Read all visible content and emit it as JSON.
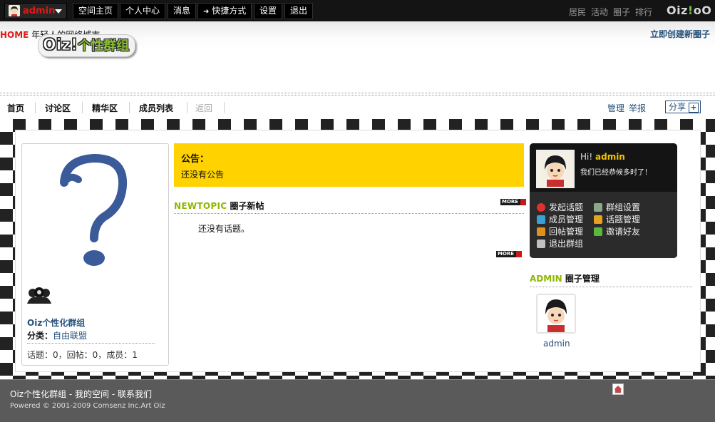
{
  "topbar": {
    "user_name": "admin",
    "nav": [
      "空间主页",
      "个人中心",
      "消息",
      "快捷方式",
      "设置",
      "退出"
    ],
    "right_links": [
      "居民",
      "活动",
      "圈子",
      "排行"
    ],
    "brand": {
      "part1": "Oiz",
      "part2": "!",
      "part3": "oO"
    }
  },
  "header": {
    "home": "HOME",
    "tagline": "年轻人的网络城市",
    "create": "立即创建新圈子",
    "logo_text": "Oiz!",
    "logo_sub": "个性群组"
  },
  "subnav": {
    "items": [
      "首页",
      "讨论区",
      "精华区",
      "成员列表",
      "返回"
    ],
    "manage": "管理",
    "report": "举报",
    "share": "分享"
  },
  "group": {
    "name": "Oiz个性化群组",
    "category_label": "分类：",
    "category": "自由联盟",
    "stats": "话题：0，回帖：0，成员：1"
  },
  "notice": {
    "title": "公告：",
    "body": "还没有公告"
  },
  "topics": {
    "label_en": "NEWTOPIC",
    "label_zh": "圈子新帖",
    "more": "MORE",
    "empty": "还没有话题。"
  },
  "userbox": {
    "hi": "Hi!",
    "name": "admin",
    "greeting": "我们已经恭候多时了！",
    "actions": [
      {
        "label": "发起话题",
        "icon": "heart-icon",
        "color": "#e23030"
      },
      {
        "label": "群组设置",
        "icon": "settings-icon",
        "color": "#7a9a7a"
      },
      {
        "label": "成员管理",
        "icon": "members-icon",
        "color": "#3aa0d8"
      },
      {
        "label": "话题管理",
        "icon": "pencil-icon",
        "color": "#e8a020"
      },
      {
        "label": "回帖管理",
        "icon": "reply-icon",
        "color": "#e0901c"
      },
      {
        "label": "邀请好友",
        "icon": "invite-icon",
        "color": "#5ab83a"
      },
      {
        "label": "退出群组",
        "icon": "exit-icon",
        "color": "#c0c0c0"
      }
    ]
  },
  "admin_section": {
    "label_en": "ADMIN",
    "label_zh": "圈子管理",
    "user": "admin"
  },
  "footer": {
    "links": "Oiz个性化群组  - 我的空间  - 联系我们",
    "copyright": "Powered © 2001-2009 Comsenz Inc.Art Oiz"
  }
}
